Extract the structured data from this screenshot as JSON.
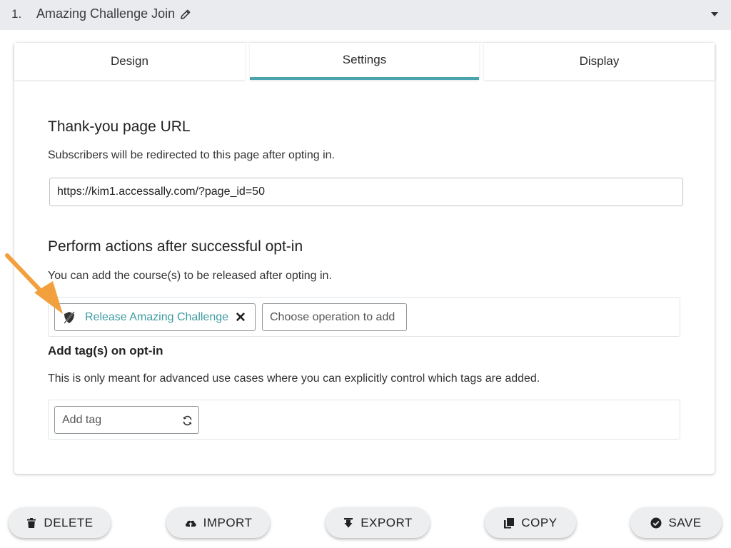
{
  "header": {
    "number": "1.",
    "title": "Amazing Challenge Join",
    "edit_icon": "pencil-icon",
    "toggle_icon": "caret-down-icon"
  },
  "tabs": [
    {
      "label": "Design",
      "active": false
    },
    {
      "label": "Settings",
      "active": true
    },
    {
      "label": "Display",
      "active": false
    }
  ],
  "thank_you": {
    "heading": "Thank-you page URL",
    "description": "Subscribers will be redirected to this page after opting in.",
    "url_value": "https://kim1.accessally.com/?page_id=50"
  },
  "actions": {
    "heading": "Perform actions after successful opt-in",
    "description": "You can add the course(s) to be released after opting in.",
    "chip_label": "Release Amazing Challenge",
    "chip_icon": "shield-icon",
    "remove_icon": "close-icon",
    "operation_placeholder": "Choose operation to add"
  },
  "tags": {
    "heading": "Add tag(s) on opt-in",
    "description": "This is only meant for advanced use cases where you can explicitly control which tags are added.",
    "placeholder": "Add tag",
    "refresh_icon": "refresh-icon"
  },
  "buttons": {
    "delete": "DELETE",
    "import": "IMPORT",
    "export": "EXPORT",
    "copy": "COPY",
    "save": "SAVE"
  },
  "colors": {
    "accent": "#4aa3ad",
    "arrow": "#f2a03d",
    "topbar": "#e9ebee"
  }
}
